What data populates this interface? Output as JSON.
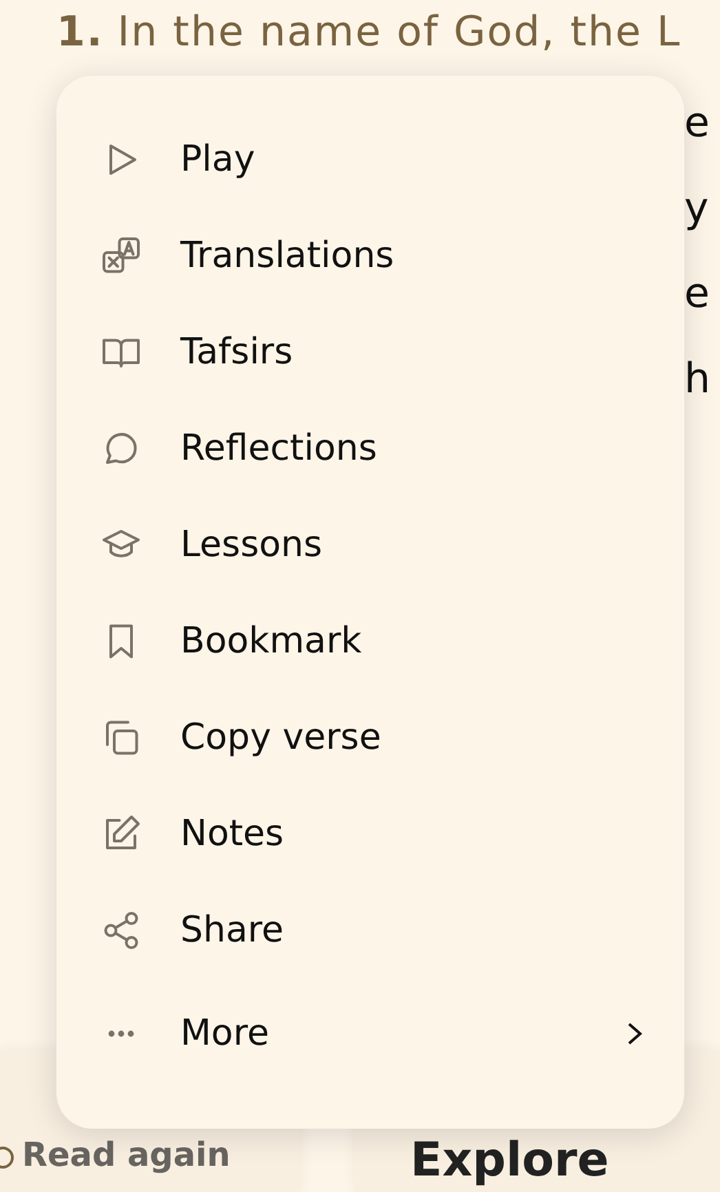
{
  "verse": {
    "number": "1.",
    "text": "In the name of God, the L"
  },
  "verse_fragments": [
    "e",
    "y",
    "e",
    "h"
  ],
  "menu": {
    "items": [
      {
        "kind": "play",
        "label": "Play"
      },
      {
        "kind": "translate",
        "label": "Translations"
      },
      {
        "kind": "book",
        "label": "Tafsirs"
      },
      {
        "kind": "chat",
        "label": "Reflections"
      },
      {
        "kind": "cap",
        "label": "Lessons"
      },
      {
        "kind": "bookmark",
        "label": "Bookmark"
      },
      {
        "kind": "copy",
        "label": "Copy verse"
      },
      {
        "kind": "edit",
        "label": "Notes"
      },
      {
        "kind": "share",
        "label": "Share"
      },
      {
        "kind": "more",
        "label": "More",
        "submenu": true
      }
    ]
  },
  "cards": [
    {
      "kind": "read",
      "label": "Read again"
    },
    {
      "kind": "explore",
      "label": "Explore"
    }
  ]
}
